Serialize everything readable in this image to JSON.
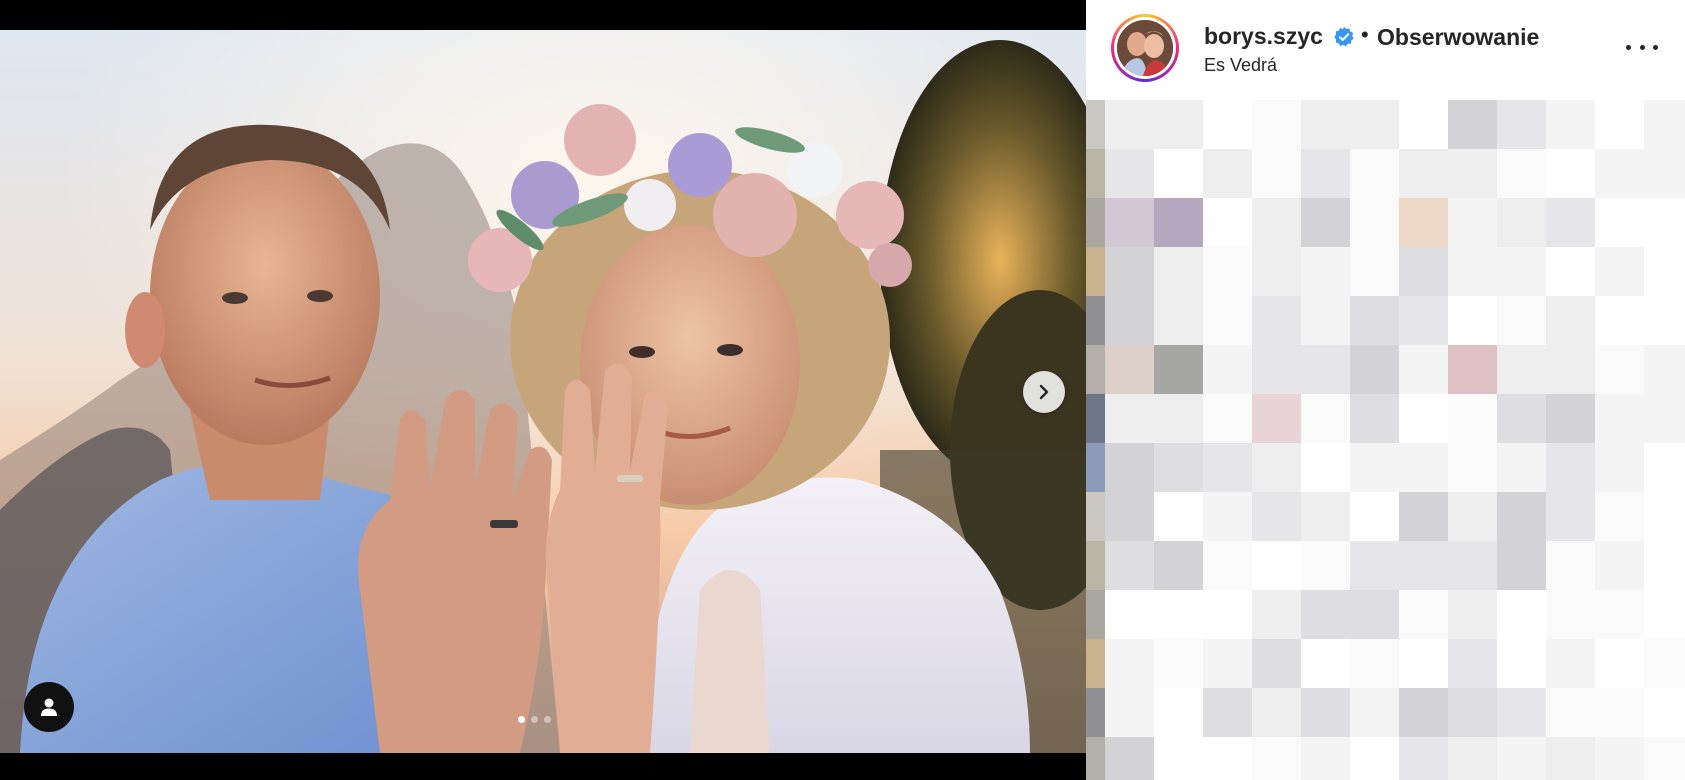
{
  "post": {
    "username": "borys.szyc",
    "verified": true,
    "separator": "•",
    "follow_label": "Obserwowanie",
    "location": "Es Vedrá"
  },
  "media": {
    "carousel_slides": 3,
    "active_slide": 1
  },
  "icons": {
    "verified": "verified-badge-icon",
    "more": "more-options-icon",
    "next": "chevron-right-icon",
    "tags": "user-tag-icon"
  },
  "colors": {
    "verified_blue": "#3897f0",
    "text": "#262626",
    "story_ring": "#ee2a7b"
  }
}
